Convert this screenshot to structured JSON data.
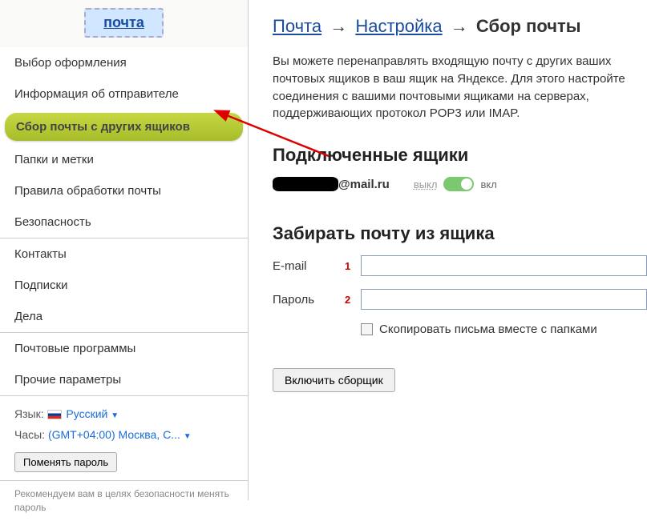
{
  "logo": "почта",
  "sidebar": {
    "groups": [
      [
        "Выбор оформления",
        "Информация об отправителе",
        "Сбор почты с других ящиков",
        "Папки и метки",
        "Правила обработки почты",
        "Безопасность"
      ],
      [
        "Контакты",
        "Подписки",
        "Дела"
      ],
      [
        "Почтовые программы",
        "Прочие параметры"
      ]
    ],
    "active_index": [
      0,
      2
    ]
  },
  "lang": {
    "label": "Язык:",
    "value": "Русский"
  },
  "tz": {
    "label": "Часы:",
    "value": "(GMT+04:00) Москва, С..."
  },
  "change_pwd": "Поменять пароль",
  "tip": "Рекомендуем вам в целях безопасности менять пароль",
  "breadcrumb": {
    "a": "Почта",
    "b": "Настройка",
    "c": "Сбор почты"
  },
  "description": "Вы можете перенаправлять входящую почту с других ваших почтовых ящиков в ваш ящик на Яндексе. Для этого настройте соединения с вашими почтовыми ящиками на серверах, поддерживающих протокол POP3 или IMAP.",
  "connected_h": "Подключенные ящики",
  "mailbox_domain": "@mail.ru",
  "toggle": {
    "off": "выкл",
    "on": "вкл"
  },
  "fetch_h": "Забирать почту из ящика",
  "form": {
    "email_label": "E-mail",
    "email_num": "1",
    "email_value": "",
    "pwd_label": "Пароль",
    "pwd_num": "2",
    "pwd_value": "",
    "copy_folders": "Скопировать письма вместе с папками"
  },
  "submit": "Включить сборщик"
}
